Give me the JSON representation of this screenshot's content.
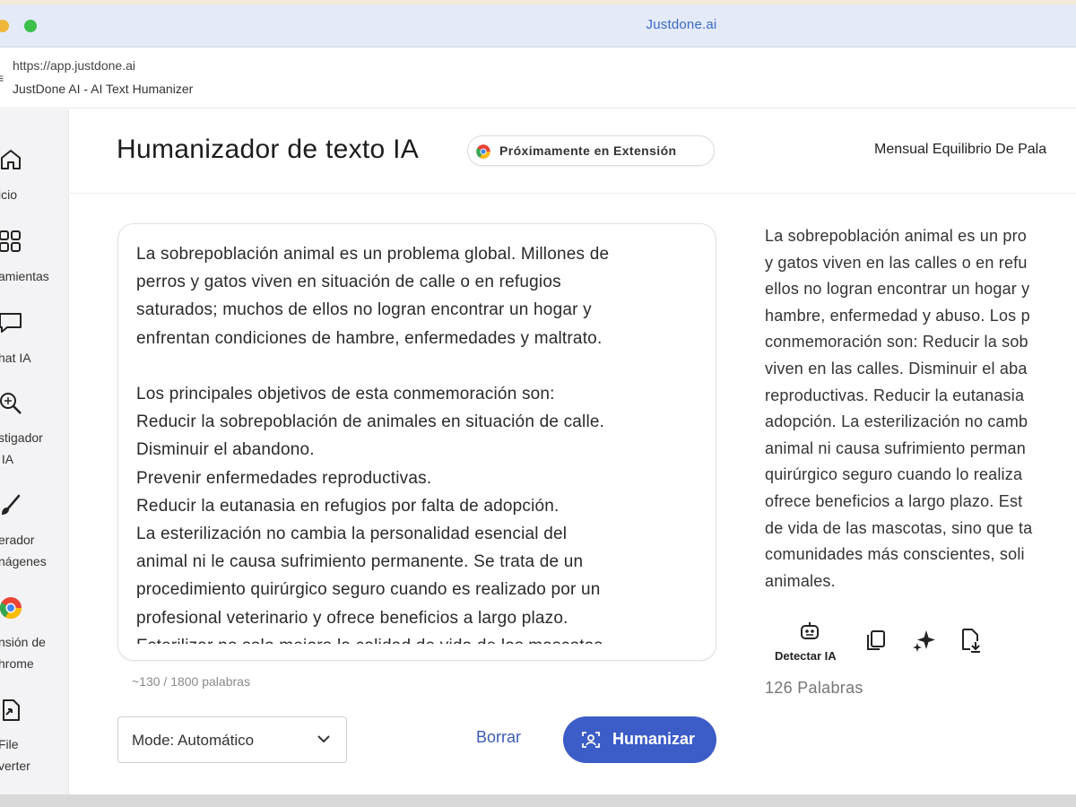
{
  "window": {
    "title": "Justdone.ai"
  },
  "browser": {
    "url": "https://app.justdone.ai",
    "page_title": "JustDone AI - AI Text Humanizer"
  },
  "sidebar": {
    "items": [
      {
        "label": "icio",
        "icon": "home-icon"
      },
      {
        "label": "amientas",
        "icon": "grid-icon"
      },
      {
        "label": "hat IA",
        "icon": "chat-icon"
      },
      {
        "label": "stigador\n IA",
        "icon": "search-icon"
      },
      {
        "label": "erador\nnágenes",
        "icon": "brush-icon"
      },
      {
        "label": "nsión de\nhrome",
        "icon": "chrome-icon"
      },
      {
        "label": "File\nverter",
        "icon": "file-convert-icon"
      }
    ]
  },
  "header": {
    "title": "Humanizador de texto IA",
    "extension_badge": "Próximamente en Extensión",
    "balance": "Mensual Equilibrio De Pala"
  },
  "input": {
    "text": "La sobrepoblación animal es un problema global. Millones de\nperros y gatos viven en situación de calle o en refugios\nsaturados; muchos de ellos no logran encontrar un hogar y\nenfrentan condiciones de hambre, enfermedades y maltrato.\n\nLos principales objetivos de esta conmemoración son:\nReducir la sobrepoblación de animales en situación de calle.\nDisminuir el abandono.\nPrevenir enfermedades reproductivas.\nReducir la eutanasia en refugios por falta de adopción.\nLa esterilización no cambia la personalidad esencial del\nanimal ni le causa sufrimiento permanente. Se trata de un\nprocedimiento quirúrgico seguro cuando es realizado por un\nprofesional veterinario y ofrece beneficios a largo plazo.\nEsterilizar no solo mejora la calidad de vida de las mascotas",
    "word_count": "~130 / 1800 palabras"
  },
  "controls": {
    "mode_select": "Mode: Automático",
    "clear_label": "Borrar",
    "humanize_label": "Humanizar"
  },
  "output": {
    "text": "La sobrepoblación animal es un pro\ny gatos viven en las calles o en refu\nellos no logran encontrar un hogar y\nhambre, enfermedad y abuso. Los p\nconmemoración son: Reducir la sob\nviven en las calles. Disminuir el aba\nreproductivas. Reducir la eutanasia\nadopción. La esterilización no camb\nanimal ni causa sufrimiento perman\nquirúrgico seguro cuando lo realiza\nofrece beneficios a largo plazo. Est\nde vida de las mascotas, sino que ta\ncomunidades más conscientes, soli\nanimales.",
    "detect_label": "Detectar IA",
    "word_count": "126 Palabras"
  },
  "colors": {
    "accent": "#3c5cc7",
    "link": "#3d5bb8",
    "titlebar": "#e4eaf8"
  }
}
